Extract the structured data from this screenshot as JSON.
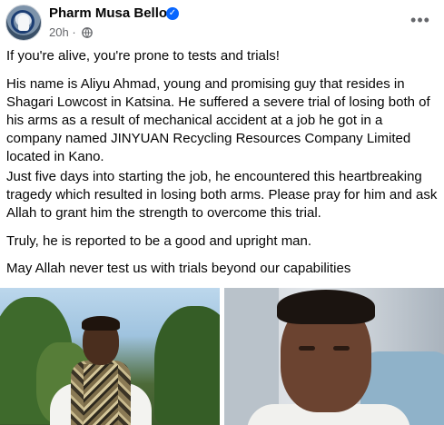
{
  "post": {
    "author": "Pharm Musa Bello",
    "time": "20h",
    "audience_icon": "globe-icon",
    "verified_icon": "verified-badge-icon",
    "more_icon": "more-options-icon",
    "paragraphs": [
      "If you're alive, you're prone to tests and trials!",
      "His name is Aliyu Ahmad, young and promising guy that resides in Shagari Lowcost in Katsina. He suffered a severe trial of losing both of his arms as a result of mechanical accident at a job he got in a company named JINYUAN Recycling Resources Company Limited located in Kano.",
      "Just five days into starting the job, he encountered this heartbreaking tragedy which resulted in losing both arms. Please pray for him and ask Allah to grant him the strength to overcome this trial.",
      "Truly, he is reported to be a good and upright man.",
      "May Allah never test us with trials beyond our capabilities"
    ]
  },
  "colors": {
    "text": "#050505",
    "secondary": "#65676b",
    "verified": "#0866ff"
  }
}
